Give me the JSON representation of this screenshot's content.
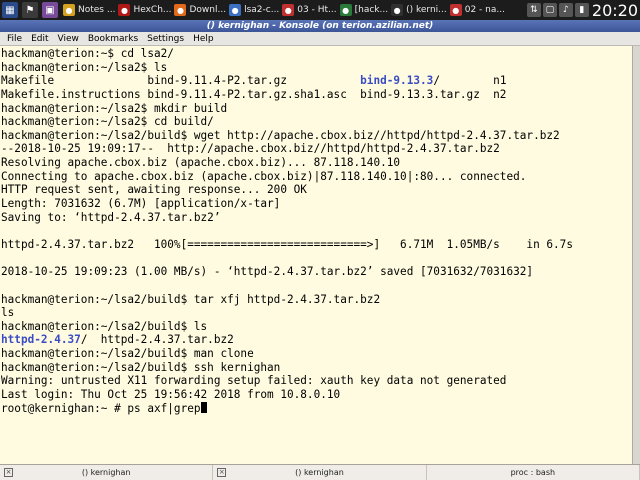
{
  "taskbar": {
    "tasks": [
      {
        "label": "Notes ...",
        "icon": "notes-icon",
        "color": "#d4a020"
      },
      {
        "label": "HexCh...",
        "icon": "hexchat-icon",
        "color": "#b01818"
      },
      {
        "label": "Downl...",
        "icon": "firefox-icon",
        "color": "#e06a1a"
      },
      {
        "label": "lsa2-c...",
        "icon": "document-icon",
        "color": "#3a6fc4"
      },
      {
        "label": "03 - Ht...",
        "icon": "video-icon",
        "color": "#c03030"
      },
      {
        "label": "[hack...",
        "icon": "browser-icon",
        "color": "#2a7a3a"
      },
      {
        "label": "() kerni...",
        "icon": "terminal-icon",
        "color": "#303030"
      },
      {
        "label": "02 - na...",
        "icon": "media-icon",
        "color": "#c03030"
      }
    ],
    "clock": "20:20"
  },
  "window": {
    "title": "() kernighan - Konsole (on terion.azilian.net)"
  },
  "menubar": [
    "File",
    "Edit",
    "View",
    "Bookmarks",
    "Settings",
    "Help"
  ],
  "terminal": {
    "lines": [
      [
        {
          "t": "hackman@terion:~$ cd lsa2/"
        }
      ],
      [
        {
          "t": "hackman@terion:~/lsa2$ ls"
        }
      ],
      [
        {
          "t": "Makefile              bind-9.11.4-P2.tar.gz           "
        },
        {
          "t": "bind-9.13.3",
          "c": "blue"
        },
        {
          "t": "/        n1"
        }
      ],
      [
        {
          "t": "Makefile.instructions bind-9.11.4-P2.tar.gz.sha1.asc  bind-9.13.3.tar.gz  n2"
        }
      ],
      [
        {
          "t": "hackman@terion:~/lsa2$ mkdir build"
        }
      ],
      [
        {
          "t": "hackman@terion:~/lsa2$ cd build/"
        }
      ],
      [
        {
          "t": "hackman@terion:~/lsa2/build$ wget http://apache.cbox.biz//httpd/httpd-2.4.37.tar.bz2"
        }
      ],
      [
        {
          "t": "--2018-10-25 19:09:17--  http://apache.cbox.biz//httpd/httpd-2.4.37.tar.bz2"
        }
      ],
      [
        {
          "t": "Resolving apache.cbox.biz (apache.cbox.biz)... 87.118.140.10"
        }
      ],
      [
        {
          "t": "Connecting to apache.cbox.biz (apache.cbox.biz)|87.118.140.10|:80... connected."
        }
      ],
      [
        {
          "t": "HTTP request sent, awaiting response... 200 OK"
        }
      ],
      [
        {
          "t": "Length: 7031632 (6.7M) [application/x-tar]"
        }
      ],
      [
        {
          "t": "Saving to: ‘httpd-2.4.37.tar.bz2’"
        }
      ],
      [
        {
          "t": ""
        }
      ],
      [
        {
          "t": "httpd-2.4.37.tar.bz2   100%[===========================>]   6.71M  1.05MB/s    in 6.7s"
        }
      ],
      [
        {
          "t": ""
        }
      ],
      [
        {
          "t": "2018-10-25 19:09:23 (1.00 MB/s) - ‘httpd-2.4.37.tar.bz2’ saved [7031632/7031632]"
        }
      ],
      [
        {
          "t": ""
        }
      ],
      [
        {
          "t": "hackman@terion:~/lsa2/build$ tar xfj httpd-2.4.37.tar.bz2"
        }
      ],
      [
        {
          "t": "ls"
        }
      ],
      [
        {
          "t": "hackman@terion:~/lsa2/build$ ls"
        }
      ],
      [
        {
          "t": "httpd-2.4.37",
          "c": "blue"
        },
        {
          "t": "/  httpd-2.4.37.tar.bz2"
        }
      ],
      [
        {
          "t": "hackman@terion:~/lsa2/build$ man clone"
        }
      ],
      [
        {
          "t": "hackman@terion:~/lsa2/build$ ssh kernighan"
        }
      ],
      [
        {
          "t": "Warning: untrusted X11 forwarding setup failed: xauth key data not generated"
        }
      ],
      [
        {
          "t": "Last login: Thu Oct 25 19:56:42 2018 from 10.8.0.10"
        }
      ],
      [
        {
          "t": "root@kernighan:~ # ps axf|grep"
        },
        {
          "t": "",
          "c": "cursor"
        }
      ]
    ]
  },
  "tabs": [
    {
      "label": "() kernighan"
    },
    {
      "label": "() kernighan"
    },
    {
      "label": "proc : bash"
    }
  ],
  "colors": {
    "background": "#fffbe0",
    "directory": "#3a4cc4",
    "titlebar": "#4a64a8"
  }
}
